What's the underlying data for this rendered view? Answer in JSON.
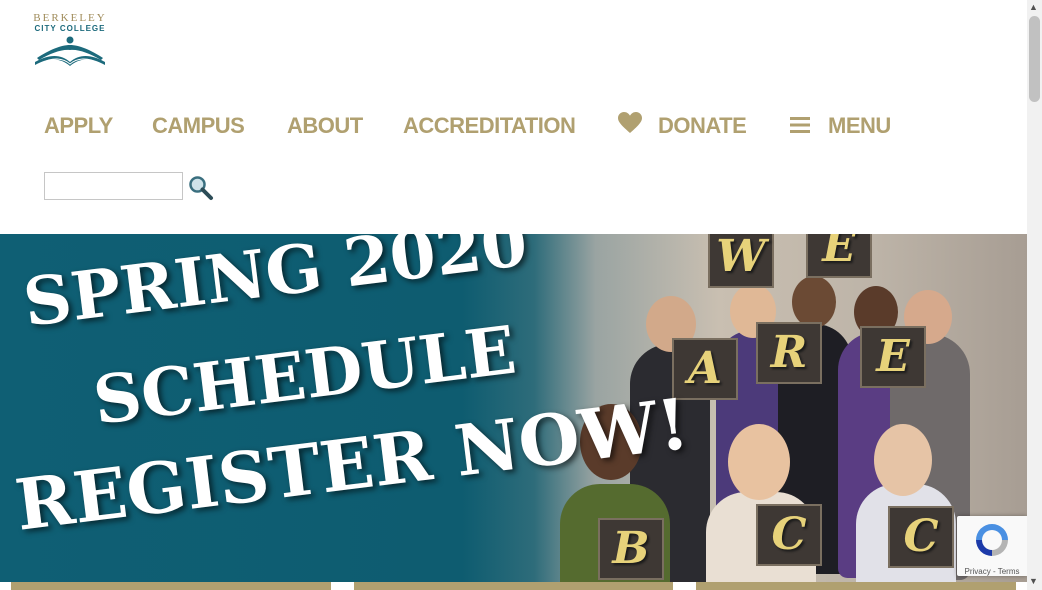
{
  "logo": {
    "line1": "BERKELEY",
    "line2": "CITY COLLEGE",
    "icon": "open-book-person-icon"
  },
  "nav": {
    "items": [
      {
        "label": "APPLY"
      },
      {
        "label": "CAMPUS"
      },
      {
        "label": "ABOUT"
      },
      {
        "label": "ACCREDITATION"
      },
      {
        "label": "DONATE",
        "icon": "heart-icon"
      },
      {
        "label": "MENU",
        "icon": "hamburger-icon"
      }
    ]
  },
  "search": {
    "value": "",
    "icon": "search-icon"
  },
  "hero": {
    "line1": "SPRING 2020",
    "line2": "SCHEDULE",
    "line3": "REGISTER NOW!",
    "signs": [
      "W",
      "E",
      "A",
      "R",
      "E",
      "B",
      "C",
      "C"
    ]
  },
  "recaptcha": {
    "privacy": "Privacy",
    "separator": " - ",
    "terms": "Terms"
  },
  "colors": {
    "gold": "#b0a070",
    "teal": "#0f5f74",
    "logo_teal": "#1c6a7c",
    "sign_text": "#e7d27a"
  }
}
